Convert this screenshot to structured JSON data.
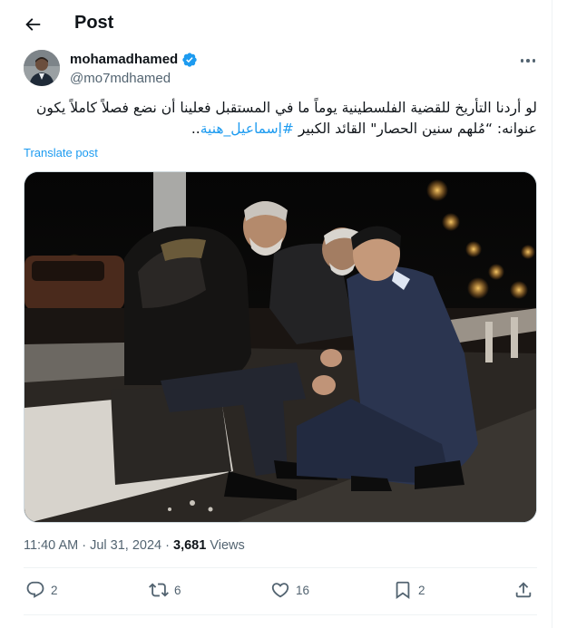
{
  "header": {
    "title": "Post",
    "back_icon": "arrow-left-icon"
  },
  "author": {
    "name": "mohamadhamed",
    "handle": "@mo7mdhamed",
    "verified": true,
    "verified_color": "#1d9bf0"
  },
  "post": {
    "text_main": "لو أردنا التأريخ للقضية الفلسطينية يوماً ما في المستقبل فعلينا أن نضع فصلاً كاملاً يكون عنوانه: “مُلهم سنين الحصار\" القائد الكبير ",
    "hashtag": "#إسماعيل_هنية",
    "text_end": "..",
    "translate_label": "Translate post"
  },
  "meta": {
    "time": "11:40 AM",
    "dot": " · ",
    "date": "Jul 31, 2024",
    "views_count": "3,681",
    "views_label": " Views"
  },
  "actions": {
    "replies": "2",
    "reposts": "6",
    "likes": "16",
    "bookmarks": "2"
  },
  "colors": {
    "accent": "#1d9bf0",
    "text_primary": "#0f1419",
    "text_secondary": "#536471",
    "divider": "#eff3f4"
  },
  "icons": {
    "reply": "speech-bubble-icon",
    "repost": "repost-arrows-icon",
    "like": "heart-icon",
    "bookmark": "bookmark-icon",
    "share": "share-upload-icon",
    "more": "three-dots-icon"
  }
}
